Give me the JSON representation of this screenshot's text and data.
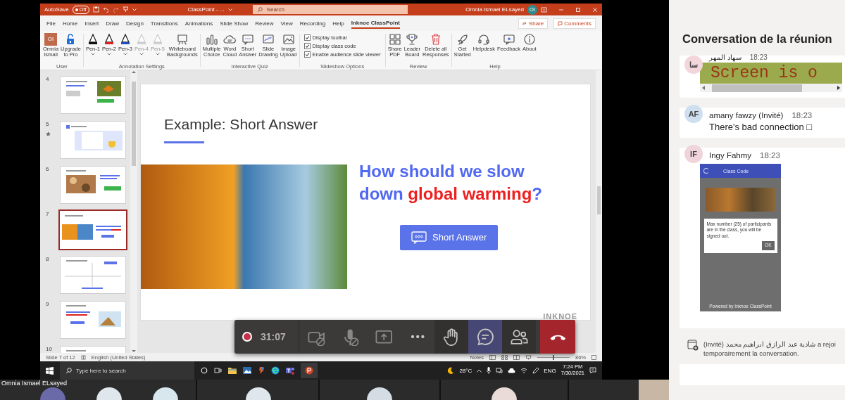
{
  "shared_screen": {
    "title_bar": {
      "autosave": {
        "label": "AutoSave",
        "on": false,
        "state_text": "Off"
      },
      "document_title": "ClassPoint - ...",
      "search_placeholder": "Search",
      "user_name": "Omnia Ismael ELsayed",
      "user_initials": "OI"
    },
    "tabs": [
      {
        "label": "File",
        "selected": false
      },
      {
        "label": "Home",
        "selected": false
      },
      {
        "label": "Insert",
        "selected": false
      },
      {
        "label": "Draw",
        "selected": false
      },
      {
        "label": "Design",
        "selected": false
      },
      {
        "label": "Transitions",
        "selected": false
      },
      {
        "label": "Animations",
        "selected": false
      },
      {
        "label": "Slide Show",
        "selected": false
      },
      {
        "label": "Review",
        "selected": false
      },
      {
        "label": "View",
        "selected": false
      },
      {
        "label": "Recording",
        "selected": false
      },
      {
        "label": "Help",
        "selected": false
      },
      {
        "label": "Inknoe ClassPoint",
        "selected": true
      }
    ],
    "share_button": "Share",
    "comments_button": "Comments",
    "ribbon_groups": [
      {
        "label": "User",
        "items": [
          {
            "kind": "avatar",
            "label": "Omnia\nIsmail",
            "initials": "OI"
          },
          {
            "kind": "button",
            "label": "Upgrade\nto Pro"
          }
        ]
      },
      {
        "label": "Annotation Settings",
        "items": [
          {
            "kind": "pen",
            "label": "Pen-1",
            "color": "#111111",
            "disabled": false
          },
          {
            "kind": "pen",
            "label": "Pen-2",
            "color": "#e02020",
            "disabled": false
          },
          {
            "kind": "pen",
            "label": "Pen-3",
            "color": "#1f4fbf",
            "disabled": false
          },
          {
            "kind": "pen",
            "label": "Pen-4",
            "color": "#cfcfcf",
            "disabled": true
          },
          {
            "kind": "pen",
            "label": "Pen-5",
            "color": "#cfcfcf",
            "disabled": true
          },
          {
            "kind": "button",
            "label": "Whiteboard\nBackgrounds"
          }
        ]
      },
      {
        "label": "Interactive Quiz",
        "items": [
          {
            "kind": "button",
            "label": "Multiple\nChoice"
          },
          {
            "kind": "button",
            "label": "Word\nCloud"
          },
          {
            "kind": "button",
            "label": "Short\nAnswer"
          },
          {
            "kind": "button",
            "label": "Slide\nDrawing"
          },
          {
            "kind": "button",
            "label": "Image\nUpload"
          }
        ]
      },
      {
        "label": "Slideshow Options",
        "items": [
          {
            "kind": "checkbox",
            "label": "Display toolbar",
            "checked": true
          },
          {
            "kind": "checkbox",
            "label": "Display class code",
            "checked": true
          },
          {
            "kind": "checkbox",
            "label": "Enable audience slide viewer",
            "checked": true
          }
        ]
      },
      {
        "label": "Review",
        "items": [
          {
            "kind": "button",
            "label": "Share\nPDF"
          },
          {
            "kind": "button",
            "label": "Leader\nBoard"
          },
          {
            "kind": "button",
            "label": "Delete all\nResponses"
          }
        ]
      },
      {
        "label": "Help",
        "items": [
          {
            "kind": "button",
            "label": "Get\nStarted"
          },
          {
            "kind": "button",
            "label": "Helpdesk"
          },
          {
            "kind": "button",
            "label": "Feedback"
          },
          {
            "kind": "button",
            "label": "About"
          }
        ]
      }
    ],
    "slides": [
      {
        "number": "4",
        "selected": false,
        "animated": false
      },
      {
        "number": "5",
        "selected": false,
        "animated": true
      },
      {
        "number": "6",
        "selected": false,
        "animated": false
      },
      {
        "number": "7",
        "selected": true,
        "animated": false
      },
      {
        "number": "8",
        "selected": false,
        "animated": false
      },
      {
        "number": "9",
        "selected": false,
        "animated": false
      },
      {
        "number": "10",
        "selected": false
      }
    ],
    "slide": {
      "title": "Example: Short Answer",
      "question": "How should we slow down **global warming**?",
      "answer_button": "Short Answer",
      "logo": "INKNOE"
    },
    "status_bar": {
      "slide_counter": "Slide 7 of 12",
      "language": "English (United States)",
      "notes": "Notes",
      "zoom_slider": {
        "level": 0.5
      },
      "zoom": "86%"
    },
    "taskbar": {
      "search_placeholder": "Type here to search",
      "temperature": "28°C",
      "language": "ENG",
      "time": "7:24 PM",
      "date": "7/30/2021"
    }
  },
  "meeting_controls": {
    "timer": "31:07",
    "buttons": [
      {
        "selected": false
      },
      {
        "selected": false
      },
      {
        "selected": false
      },
      {
        "selected": false
      },
      {
        "selected": false
      },
      {
        "selected": true
      },
      {
        "selected": false
      }
    ]
  },
  "presenter_label": "Omnia Ismael ELsayed",
  "chat": {
    "title": "Conversation de la réunion",
    "messages": [
      {
        "kind": "code",
        "initials": "سا",
        "color": "#f3d6dc",
        "sender": "سهاد المهر",
        "time": "18:23",
        "code": "Screen is o"
      },
      {
        "kind": "text",
        "initials": "AF",
        "color": "#cfdff0",
        "sender": "amany fawzy (Invité)",
        "time": "18:23",
        "text": "There's bad connection □"
      },
      {
        "kind": "image",
        "initials": "IF",
        "color": "#efd5da",
        "sender": "Ingy Fahmy",
        "time": "18:23",
        "image": {
          "header": "Class Code",
          "dialog": "Max number (25) of participants are in the class, you will be signed out.",
          "ok": "OK",
          "footer": "Powered by Inknoe ClassPoint"
        }
      }
    ],
    "system_message": {
      "lines": [
        "(Invité) شادية عبد الرازق ابراهيم محمد a rejoi",
        "temporairement la conversation."
      ]
    }
  }
}
